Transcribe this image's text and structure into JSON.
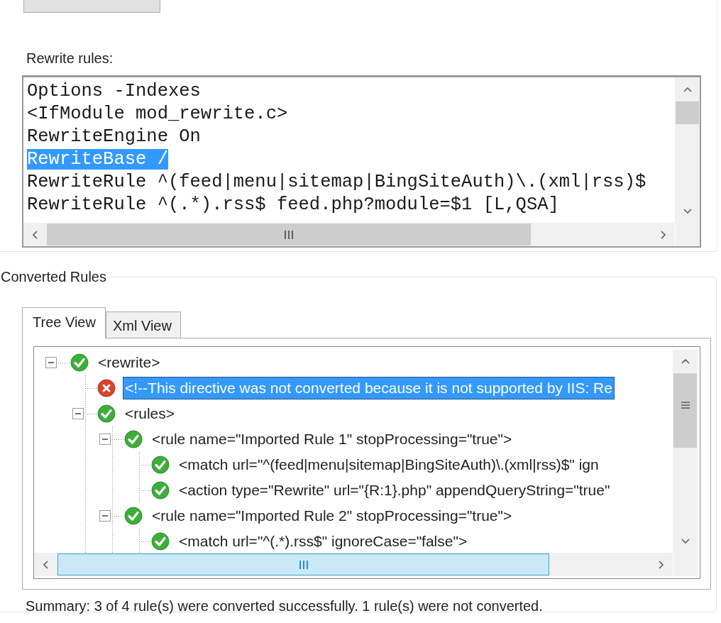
{
  "rewrite_rules": {
    "label": "Rewrite rules:",
    "lines": [
      {
        "text": "Options -Indexes",
        "selected": false
      },
      {
        "text": "<IfModule mod_rewrite.c>",
        "selected": false
      },
      {
        "text": "RewriteEngine On",
        "selected": false
      },
      {
        "text": "RewriteBase /",
        "selected": true
      },
      {
        "text": "RewriteRule ^(feed|menu|sitemap|BingSiteAuth)\\.(xml|rss)$",
        "selected": false
      },
      {
        "text": "RewriteRule ^(.*).rss$ feed.php?module=$1 [L,QSA]",
        "selected": false
      }
    ]
  },
  "converted_rules": {
    "title": "Converted Rules",
    "tabs": [
      {
        "label": "Tree View",
        "selected": true
      },
      {
        "label": "Xml View",
        "selected": false
      }
    ],
    "tree": [
      {
        "text": "<rewrite>",
        "converted": true,
        "selected": false,
        "expanded": true,
        "children": [
          {
            "text": "<!--This directive was not converted because it is not supported by IIS: Re",
            "converted": false,
            "selected": true
          },
          {
            "text": "<rules>",
            "converted": true,
            "selected": false,
            "expanded": true,
            "children": [
              {
                "text": "<rule name=\"Imported Rule 1\" stopProcessing=\"true\">",
                "converted": true,
                "selected": false,
                "expanded": true,
                "children": [
                  {
                    "text": "<match url=\"^(feed|menu|sitemap|BingSiteAuth)\\.(xml|rss)$\" ign",
                    "converted": true,
                    "selected": false
                  },
                  {
                    "text": "<action type=\"Rewrite\" url=\"{R:1}.php\" appendQueryString=\"true\"",
                    "converted": true,
                    "selected": false
                  }
                ]
              },
              {
                "text": "<rule name=\"Imported Rule 2\" stopProcessing=\"true\">",
                "converted": true,
                "selected": false,
                "expanded": true,
                "children": [
                  {
                    "text": "<match url=\"^(.*).rss$\" ignoreCase=\"false\">",
                    "converted": true,
                    "selected": false
                  }
                ]
              }
            ]
          }
        ]
      }
    ]
  },
  "summary": "Summary: 3 of 4 rule(s) were converted successfully. 1 rule(s) were not converted."
}
